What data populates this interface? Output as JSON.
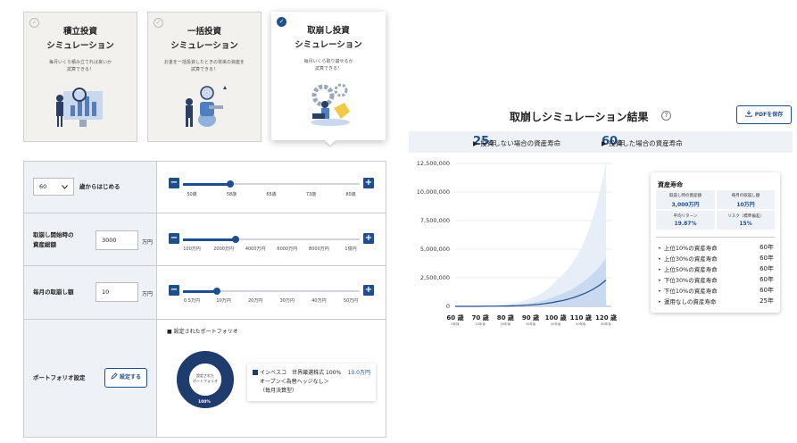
{
  "cards": [
    {
      "title1": "積立投資",
      "title2": "シミュレーション",
      "desc1": "毎月いくら積み立てれば良いか",
      "desc2": "試算できる！",
      "check": "✓",
      "active": false
    },
    {
      "title1": "一括投資",
      "title2": "シミュレーション",
      "desc1": "お金を一括投資したときの将来の資産を",
      "desc2": "試算できる！",
      "check": "✓",
      "active": false
    },
    {
      "title1": "取崩し投資",
      "title2": "シミュレーション",
      "desc1": "毎月いくら取り崩せるか",
      "desc2": "試算できる！",
      "check": "✓",
      "active": true
    }
  ],
  "form": {
    "age": {
      "select_value": "60",
      "label": "歳からはじめる",
      "ticks": [
        "50歳",
        "58歳",
        "65歳",
        "73歳",
        "80歳"
      ],
      "slider_fraction": 0.27
    },
    "assets": {
      "label1": "取崩し開始時の",
      "label2": "資産総額",
      "value": "3000",
      "unit": "万円",
      "ticks": [
        "100万円",
        "2000万円",
        "4000万円",
        "6000万円",
        "8000万円",
        "1億円"
      ],
      "slider_fraction": 0.3
    },
    "monthly": {
      "label": "毎月の取崩し額",
      "value": "10",
      "unit": "万円",
      "ticks": [
        "0.5万円",
        "10万円",
        "20万円",
        "30万円",
        "40万円",
        "50万円"
      ],
      "slider_fraction": 0.19
    },
    "portfolio": {
      "label": "ポートフォリオ設定",
      "button": "設定する",
      "heading": "■ 設定されたポートフォリオ",
      "donut_center1": "設定された",
      "donut_center2": "ポートフォリオ",
      "donut_percent": "100%",
      "fund_line1": "インベスコ　世界厳選株式",
      "fund_pct": "100%",
      "fund_amount": "10.0万円",
      "fund_line2": "オープン＜為替ヘッジなし＞",
      "fund_line3": "（毎月決算型）"
    },
    "minus": "−",
    "plus": "+"
  },
  "result": {
    "title": "取崩しシミュレーション結果",
    "help": "?",
    "pdf_button": "PDFを保存",
    "no_invest_prefix": "▶ 投資しない場合の資産寿命",
    "no_invest_value": "25",
    "no_invest_unit": "年",
    "invest_prefix": "▶ 投資した場合の資産寿命",
    "invest_value": "60",
    "invest_unit": "年"
  },
  "chart_data": {
    "type": "area",
    "y_ticks": [
      "12,500,000",
      "10,000,000",
      "7,500,000",
      "5,000,000",
      "2,500,000",
      "0"
    ],
    "ylim": [
      0,
      12500000
    ],
    "x": [
      "60",
      "70",
      "80",
      "90",
      "100",
      "110",
      "120"
    ],
    "x_unit": "歳",
    "x_sub": [
      "0年後",
      "10年後",
      "20年後",
      "30年後",
      "40年後",
      "50年後",
      "60年後"
    ],
    "median": [
      0,
      8000,
      30000,
      120000,
      400000,
      1000000,
      2300000
    ],
    "band_inner_upper": [
      0,
      20000,
      80000,
      300000,
      900000,
      2000000,
      4200000
    ],
    "band_outer_upper": [
      0,
      40000,
      200000,
      700000,
      2200000,
      5000000,
      12500000
    ],
    "colors": {
      "line": "#1f4e8c",
      "inner": "#c9daf0",
      "outer": "#e6eef8"
    }
  },
  "panel": {
    "heading": "資産寿命",
    "cells": [
      {
        "k": "取崩し時の資産額",
        "v": "3,000万円"
      },
      {
        "k": "毎月の取崩し額",
        "v": "10万円"
      },
      {
        "k": "平均リターン",
        "v": "19.87%"
      },
      {
        "k": "リスク（標準偏差）",
        "v": "15%"
      }
    ],
    "rows": [
      {
        "label": "上位10%の資産寿命",
        "value": "60年"
      },
      {
        "label": "上位30%の資産寿命",
        "value": "60年"
      },
      {
        "label": "上位50%の資産寿命",
        "value": "60年"
      },
      {
        "label": "下位30%の資産寿命",
        "value": "60年"
      },
      {
        "label": "下位10%の資産寿命",
        "value": "60年"
      },
      {
        "label": "運用なしの資産寿命",
        "value": "25年"
      }
    ]
  }
}
